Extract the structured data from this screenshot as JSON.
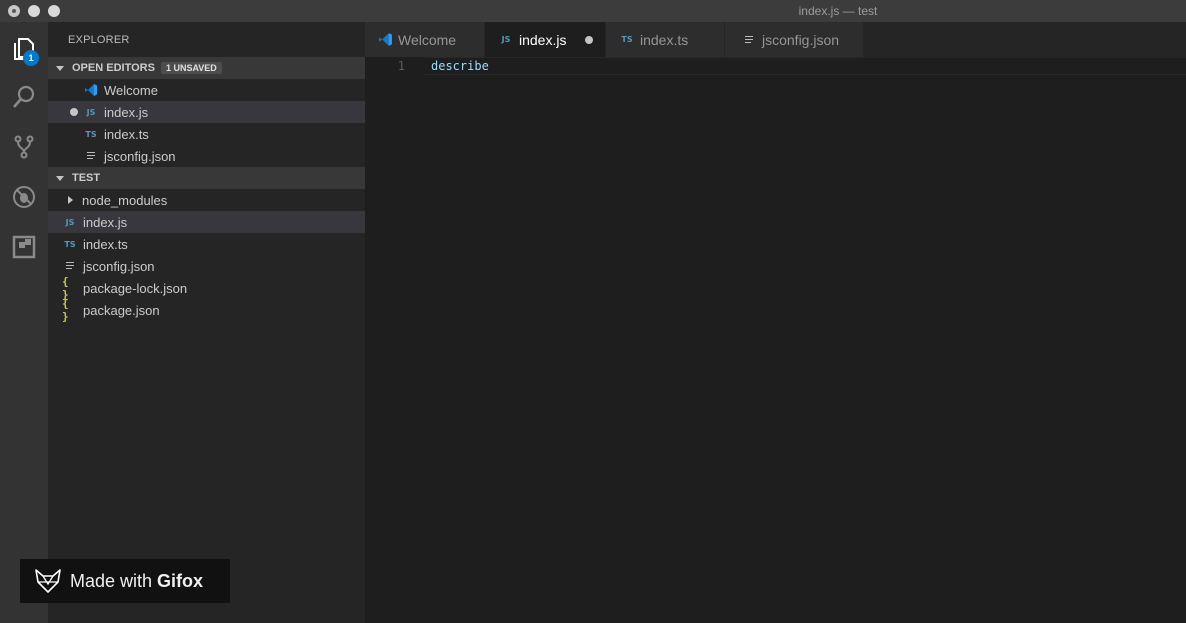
{
  "window": {
    "title": "index.js — test"
  },
  "activity_bar": {
    "items": [
      {
        "name": "explorer",
        "icon": "files-icon",
        "badge": "1"
      },
      {
        "name": "search",
        "icon": "search-icon"
      },
      {
        "name": "source-control",
        "icon": "git-branch-icon"
      },
      {
        "name": "debug",
        "icon": "bug-icon"
      },
      {
        "name": "extensions",
        "icon": "extensions-icon"
      }
    ]
  },
  "sidebar": {
    "title": "EXPLORER",
    "open_editors": {
      "header": "OPEN EDITORS",
      "badge": "1 UNSAVED",
      "items": [
        {
          "label": "Welcome",
          "icon": "vscode-icon"
        },
        {
          "label": "index.js",
          "icon": "js-icon",
          "glyph": "JS",
          "dirty": true
        },
        {
          "label": "index.ts",
          "icon": "ts-icon",
          "glyph": "TS"
        },
        {
          "label": "jsconfig.json",
          "icon": "lines-icon"
        }
      ]
    },
    "folder": {
      "header": "TEST",
      "items": [
        {
          "label": "node_modules",
          "icon": "chevron-right-icon"
        },
        {
          "label": "index.js",
          "icon": "js-icon",
          "glyph": "JS"
        },
        {
          "label": "index.ts",
          "icon": "ts-icon",
          "glyph": "TS"
        },
        {
          "label": "jsconfig.json",
          "icon": "lines-icon"
        },
        {
          "label": "package-lock.json",
          "icon": "json-icon",
          "glyph": "{ }"
        },
        {
          "label": "package.json",
          "icon": "json-icon",
          "glyph": "{ }"
        }
      ]
    }
  },
  "tabs": [
    {
      "label": "Welcome",
      "icon": "vscode-icon"
    },
    {
      "label": "index.js",
      "icon": "js-icon",
      "glyph": "JS",
      "active": true,
      "dirty": true
    },
    {
      "label": "index.ts",
      "icon": "ts-icon",
      "glyph": "TS"
    },
    {
      "label": "jsconfig.json",
      "icon": "lines-icon"
    }
  ],
  "editor": {
    "lines": [
      {
        "number": "1",
        "text": "describe"
      }
    ]
  },
  "watermark": {
    "prefix": "Made with",
    "brand": "Gifox"
  },
  "colors": {
    "accent": "#007acc",
    "js": "#519aba",
    "json": "#cbcb41",
    "code": "#9cdcfe"
  }
}
